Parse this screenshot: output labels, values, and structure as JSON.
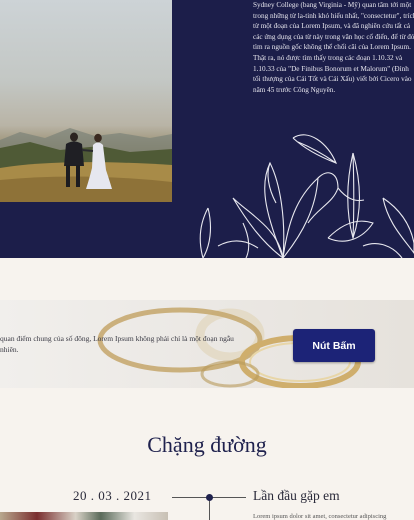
{
  "hero": {
    "paragraph": "Sydney College (bang Virginia - Mỹ) quan tâm tới một trong những từ la-tinh khó hiểu nhất, \"consectetur\", trích từ một đoạn của Lorem Ipsum, và đã nghiên cứu tất cả các ứng dụng của từ này trong văn học cổ điển, để từ đó tìm ra nguồn gốc không thể chối cãi của Lorem Ipsum. Thật ra, nó được tìm thấy trong các đoạn 1.10.32 và 1.10.33 của \"De Finibus Bonorum et Malorum\" (Đỉnh tối thượng của Cái Tốt và Cái Xấu) viết bởi Cicero vào năm 45 trước Công Nguyên."
  },
  "banner": {
    "text": "quan điểm chung của số đông, Lorem Ipsum không phải chỉ là một đoạn ngẫu nhiên.",
    "button_label": "Nút Bấm"
  },
  "timeline": {
    "title": "Chặng đường",
    "items": [
      {
        "date": "20 . 03 . 2021",
        "title": "Lần đầu gặp em",
        "text": "Lorem ipsum dolor sit amet, consectetur adipiscing"
      }
    ]
  }
}
